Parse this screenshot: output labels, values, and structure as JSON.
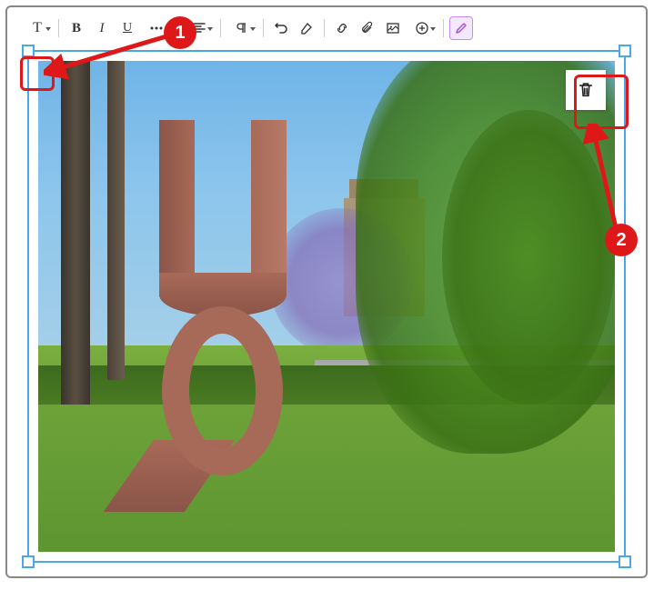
{
  "toolbar": {
    "text_dd": "T",
    "bold": "B",
    "italic": "I",
    "underline": "U"
  },
  "image": {
    "description": "UQ sculpture letters on campus lawn with jacaranda and sandstone building"
  },
  "annotations": {
    "marker1": "1",
    "marker2": "2"
  }
}
